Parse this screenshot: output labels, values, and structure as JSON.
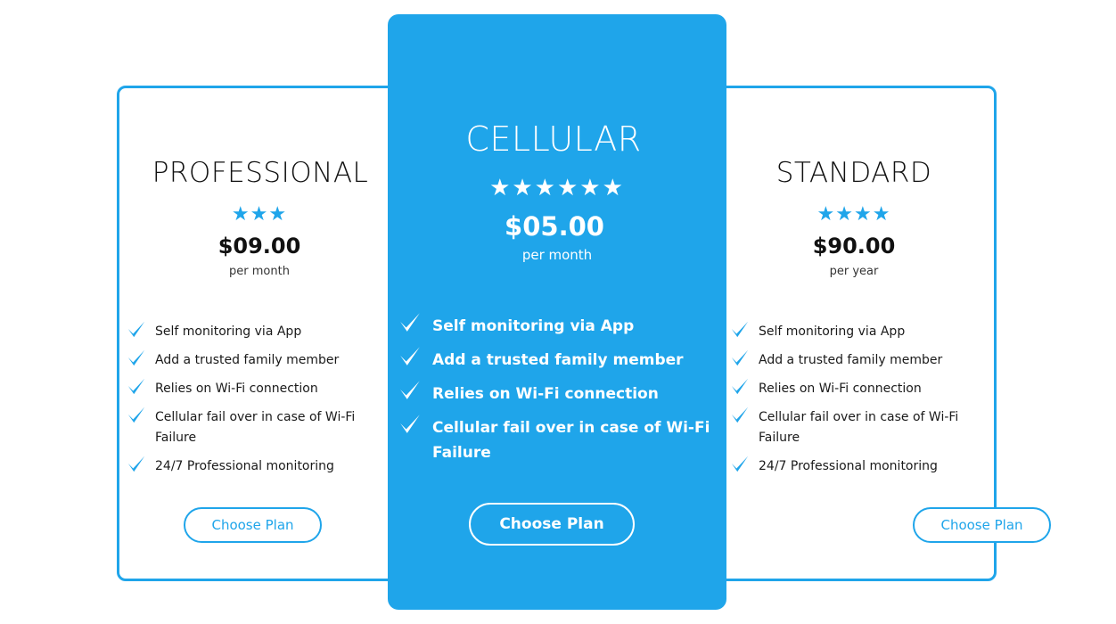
{
  "colors": {
    "accent": "#1fa5ea",
    "background": "#ffffff",
    "text": "#111111"
  },
  "plans": [
    {
      "title": "PROFESSIONAL",
      "stars": "★★★",
      "rating": 3,
      "price": "$09.00",
      "period": "per month",
      "features": [
        "Self monitoring via App",
        "Add a trusted family member",
        "Relies on Wi-Fi connection",
        "Cellular fail over in case of Wi-Fi Failure",
        "24/7 Professional monitoring"
      ],
      "button": "Choose Plan",
      "feature_icon": "checkmark-icon"
    },
    {
      "title": "CELLULAR",
      "stars": "★★★★★★",
      "rating": 6,
      "price": "$05.00",
      "period": "per month",
      "features": [
        "Self monitoring via App",
        "Add a trusted family member",
        "Relies on Wi-Fi connection",
        "Cellular fail over in case of Wi-Fi Failure"
      ],
      "button": "Choose Plan",
      "feature_icon": "checkmark-icon"
    },
    {
      "title": "STANDARD",
      "stars": "★★★★",
      "rating": 4,
      "price": "$90.00",
      "period": "per year",
      "features": [
        "Self monitoring via App",
        "Add a trusted family member",
        "Relies on Wi-Fi connection",
        "Cellular fail over in case of Wi-Fi Failure",
        "24/7 Professional monitoring"
      ],
      "button": "Choose Plan",
      "feature_icon": "checkmark-icon"
    }
  ]
}
